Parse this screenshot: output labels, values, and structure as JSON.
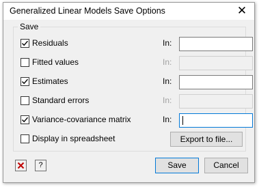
{
  "window": {
    "title": "Generalized Linear Models Save Options"
  },
  "group": {
    "legend": "Save"
  },
  "in_label": "In:",
  "rows": [
    {
      "label": "Residuals",
      "checked": true,
      "field_enabled": true,
      "value": ""
    },
    {
      "label": "Fitted values",
      "checked": false,
      "field_enabled": false,
      "value": ""
    },
    {
      "label": "Estimates",
      "checked": true,
      "field_enabled": true,
      "value": ""
    },
    {
      "label": "Standard errors",
      "checked": false,
      "field_enabled": false,
      "value": ""
    },
    {
      "label": "Variance-covariance matrix",
      "checked": true,
      "field_enabled": true,
      "value": ""
    },
    {
      "label": "Display in spreadsheet",
      "checked": false
    }
  ],
  "buttons": {
    "export": "Export to file...",
    "save": "Save",
    "cancel": "Cancel",
    "clear_icon": "red-x-icon",
    "help_icon": "question-mark-icon"
  },
  "colors": {
    "focus_border": "#0078d7",
    "clear_icon": "#c00000"
  }
}
